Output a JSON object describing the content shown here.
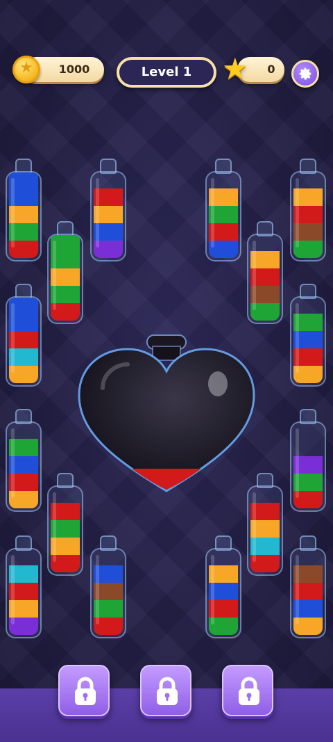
{
  "hud": {
    "coins": "1000",
    "level": "Level 1",
    "stars": "0"
  },
  "colors": {
    "blue": "#1f4fd8",
    "orange": "#f7a628",
    "green": "#1fa535",
    "red": "#d31a1a",
    "purple": "#7a2fd6",
    "cyan": "#22b8d0",
    "brown": "#8a4a2a"
  },
  "tubes": [
    {
      "id": "t1",
      "layers": [
        "red",
        "green",
        "orange",
        "blue",
        "blue"
      ]
    },
    {
      "id": "t2",
      "layers": [
        "purple",
        "blue",
        "orange",
        "red"
      ]
    },
    {
      "id": "t3",
      "layers": [
        "blue",
        "red",
        "green",
        "orange"
      ]
    },
    {
      "id": "t4",
      "layers": [
        "green",
        "brown",
        "red",
        "orange"
      ]
    },
    {
      "id": "t5",
      "layers": [
        "red",
        "green",
        "orange",
        "green",
        "green"
      ]
    },
    {
      "id": "t6",
      "layers": [
        "green",
        "brown",
        "red",
        "orange"
      ]
    },
    {
      "id": "t7",
      "layers": [
        "orange",
        "cyan",
        "red",
        "blue",
        "blue"
      ]
    },
    {
      "id": "t8",
      "layers": [
        "orange",
        "red",
        "blue",
        "green"
      ]
    },
    {
      "id": "t9",
      "layers": [
        "orange",
        "red",
        "blue",
        "green"
      ]
    },
    {
      "id": "t10",
      "layers": [
        "red",
        "green",
        "purple"
      ]
    },
    {
      "id": "t11",
      "layers": [
        "red",
        "orange",
        "green",
        "red"
      ]
    },
    {
      "id": "t12",
      "layers": [
        "red",
        "cyan",
        "orange",
        "red"
      ]
    },
    {
      "id": "t13",
      "layers": [
        "purple",
        "orange",
        "red",
        "cyan"
      ]
    },
    {
      "id": "t14",
      "layers": [
        "red",
        "green",
        "brown",
        "blue"
      ]
    },
    {
      "id": "t15",
      "layers": [
        "green",
        "red",
        "blue",
        "orange"
      ]
    },
    {
      "id": "t16",
      "layers": [
        "orange",
        "blue",
        "red",
        "brown"
      ]
    }
  ],
  "heart_bottle": {
    "fill_color": "red",
    "fill_level": 0.06
  },
  "locked_slots": 3
}
